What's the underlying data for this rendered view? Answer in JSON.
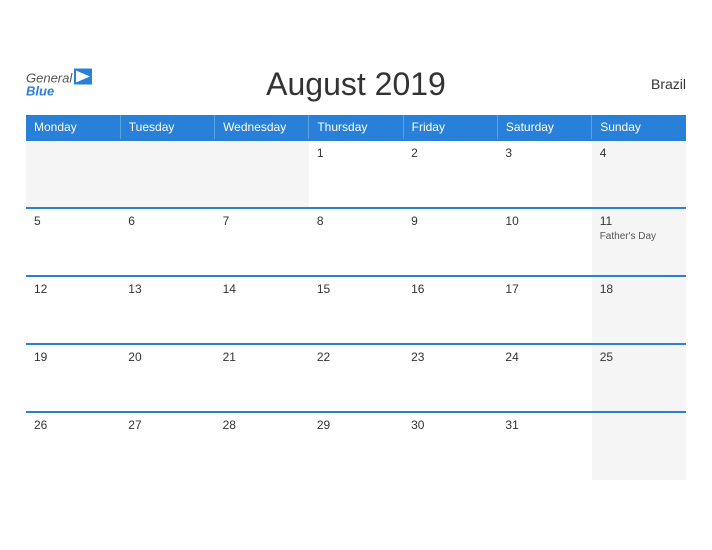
{
  "header": {
    "title": "August 2019",
    "country": "Brazil",
    "logo_general": "General",
    "logo_blue": "Blue"
  },
  "weekdays": [
    "Monday",
    "Tuesday",
    "Wednesday",
    "Thursday",
    "Friday",
    "Saturday",
    "Sunday"
  ],
  "weeks": [
    [
      {
        "day": "",
        "empty": true
      },
      {
        "day": "",
        "empty": true
      },
      {
        "day": "",
        "empty": true
      },
      {
        "day": "1",
        "holiday": ""
      },
      {
        "day": "2",
        "holiday": ""
      },
      {
        "day": "3",
        "holiday": ""
      },
      {
        "day": "4",
        "holiday": ""
      }
    ],
    [
      {
        "day": "5",
        "holiday": ""
      },
      {
        "day": "6",
        "holiday": ""
      },
      {
        "day": "7",
        "holiday": ""
      },
      {
        "day": "8",
        "holiday": ""
      },
      {
        "day": "9",
        "holiday": ""
      },
      {
        "day": "10",
        "holiday": ""
      },
      {
        "day": "11",
        "holiday": "Father's Day"
      }
    ],
    [
      {
        "day": "12",
        "holiday": ""
      },
      {
        "day": "13",
        "holiday": ""
      },
      {
        "day": "14",
        "holiday": ""
      },
      {
        "day": "15",
        "holiday": ""
      },
      {
        "day": "16",
        "holiday": ""
      },
      {
        "day": "17",
        "holiday": ""
      },
      {
        "day": "18",
        "holiday": ""
      }
    ],
    [
      {
        "day": "19",
        "holiday": ""
      },
      {
        "day": "20",
        "holiday": ""
      },
      {
        "day": "21",
        "holiday": ""
      },
      {
        "day": "22",
        "holiday": ""
      },
      {
        "day": "23",
        "holiday": ""
      },
      {
        "day": "24",
        "holiday": ""
      },
      {
        "day": "25",
        "holiday": ""
      }
    ],
    [
      {
        "day": "26",
        "holiday": ""
      },
      {
        "day": "27",
        "holiday": ""
      },
      {
        "day": "28",
        "holiday": ""
      },
      {
        "day": "29",
        "holiday": ""
      },
      {
        "day": "30",
        "holiday": ""
      },
      {
        "day": "31",
        "holiday": ""
      },
      {
        "day": "",
        "empty": true
      }
    ]
  ]
}
